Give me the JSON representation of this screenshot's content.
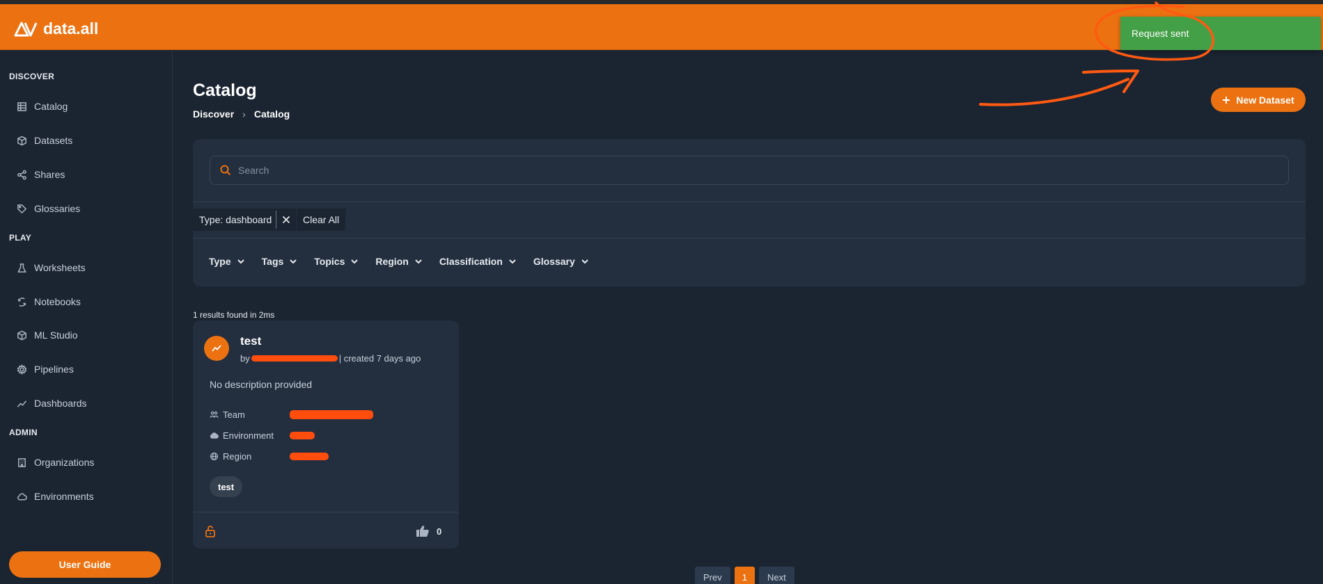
{
  "app": {
    "name": "data.all"
  },
  "toast": {
    "message": "Request sent",
    "color": "#43a047"
  },
  "colors": {
    "accent": "#ec7211",
    "background": "#1b2431",
    "panel": "#232e3e"
  },
  "sidebar": {
    "sections": [
      {
        "title": "DISCOVER",
        "items": [
          {
            "label": "Catalog",
            "icon": "catalog-icon"
          },
          {
            "label": "Datasets",
            "icon": "cube-icon"
          },
          {
            "label": "Shares",
            "icon": "share-icon"
          },
          {
            "label": "Glossaries",
            "icon": "tag-icon"
          }
        ]
      },
      {
        "title": "PLAY",
        "items": [
          {
            "label": "Worksheets",
            "icon": "flask-icon"
          },
          {
            "label": "Notebooks",
            "icon": "notebook-icon"
          },
          {
            "label": "ML Studio",
            "icon": "cube-icon"
          },
          {
            "label": "Pipelines",
            "icon": "gear-icon"
          },
          {
            "label": "Dashboards",
            "icon": "chart-line-icon"
          }
        ]
      },
      {
        "title": "ADMIN",
        "items": [
          {
            "label": "Organizations",
            "icon": "building-icon"
          },
          {
            "label": "Environments",
            "icon": "cloud-icon"
          }
        ]
      }
    ],
    "user_guide_label": "User Guide"
  },
  "page": {
    "title": "Catalog",
    "breadcrumb": [
      "Discover",
      "Catalog"
    ],
    "new_dataset_label": "New Dataset"
  },
  "search": {
    "placeholder": "Search",
    "value": ""
  },
  "active_filter": {
    "label": "Type: dashboard",
    "clear_all_label": "Clear All"
  },
  "facets": [
    "Type",
    "Tags",
    "Topics",
    "Region",
    "Classification",
    "Glossary"
  ],
  "results": {
    "summary": "1 results found in 2ms",
    "items": [
      {
        "title": "test",
        "by_prefix": "by",
        "created": "| created 7 days ago",
        "description": "No description provided",
        "meta": [
          {
            "label": "Team",
            "icon": "team-icon"
          },
          {
            "label": "Environment",
            "icon": "cloud-icon"
          },
          {
            "label": "Region",
            "icon": "globe-icon"
          }
        ],
        "tag": "test",
        "likes": "0"
      }
    ]
  },
  "pagination": {
    "prev_label": "Prev",
    "current_page": "1",
    "next_label": "Next"
  }
}
